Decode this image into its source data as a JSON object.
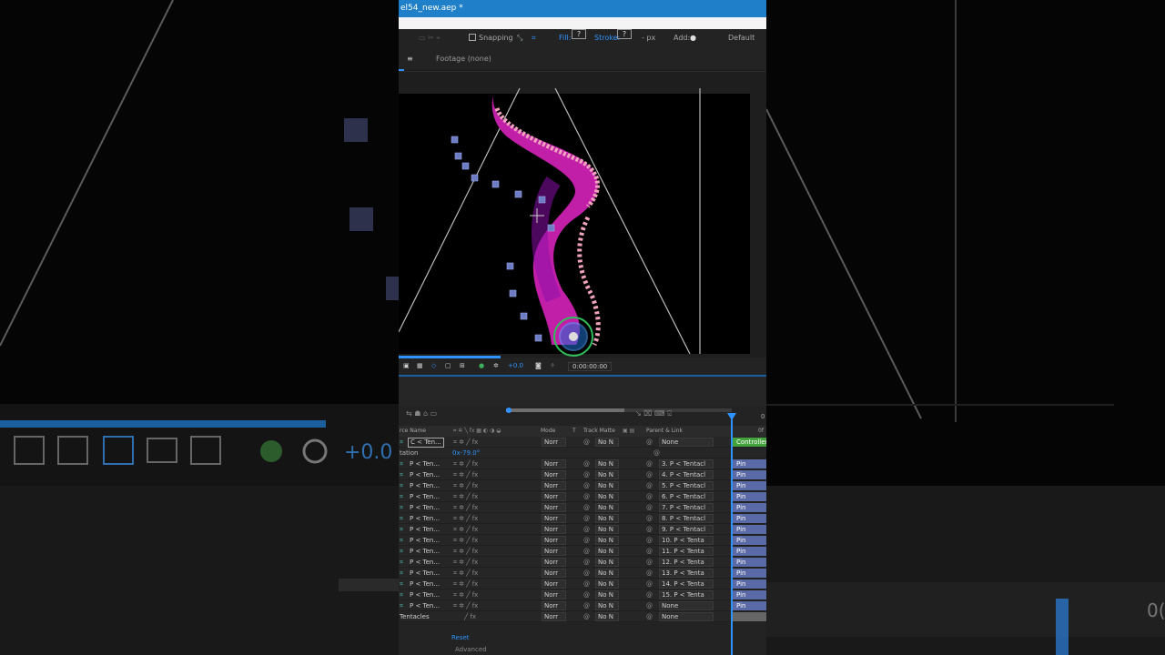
{
  "window": {
    "title": "el54_new.aep *"
  },
  "toolbar": {
    "snapping_label": "Snapping",
    "fill_label": "Fill:",
    "fill_value": "?",
    "stroke_label": "Stroke:",
    "stroke_value": "?",
    "stroke_unit": "- px",
    "add_label": "Add:",
    "workspace": "Default"
  },
  "panel": {
    "menu_icon": "≡",
    "footage_tab": "Footage (none)"
  },
  "viewer": {
    "exposure": "+0.0",
    "timecode": "0:00:00:00"
  },
  "timeline": {
    "headers": {
      "name": "rce Name",
      "mode": "Mode",
      "t": "T",
      "track_matte": "Track Matte",
      "parent": "Parent & Link",
      "ruler_end": "0f"
    },
    "controller": {
      "name": "C < Ten...",
      "mode": "Norr",
      "tm": "No N",
      "parent": "None",
      "bar": "Controller"
    },
    "rotation": {
      "label": "tation",
      "value": "0x-79.0°"
    },
    "rows": [
      {
        "name": "P < Ten...",
        "mode": "Norr",
        "tm": "No N",
        "parent": "3. P < Tentacl",
        "bar": "Pin"
      },
      {
        "name": "P < Ten...",
        "mode": "Norr",
        "tm": "No N",
        "parent": "4. P < Tentacl",
        "bar": "Pin"
      },
      {
        "name": "P < Ten...",
        "mode": "Norr",
        "tm": "No N",
        "parent": "5. P < Tentacl",
        "bar": "Pin"
      },
      {
        "name": "P < Ten...",
        "mode": "Norr",
        "tm": "No N",
        "parent": "6. P < Tentacl",
        "bar": "Pin"
      },
      {
        "name": "P < Ten...",
        "mode": "Norr",
        "tm": "No N",
        "parent": "7. P < Tentacl",
        "bar": "Pin"
      },
      {
        "name": "P < Ten...",
        "mode": "Norr",
        "tm": "No N",
        "parent": "8. P < Tentacl",
        "bar": "Pin"
      },
      {
        "name": "P < Ten...",
        "mode": "Norr",
        "tm": "No N",
        "parent": "9. P < Tentacl",
        "bar": "Pin"
      },
      {
        "name": "P < Ten...",
        "mode": "Norr",
        "tm": "No N",
        "parent": "10. P < Tenta",
        "bar": "Pin"
      },
      {
        "name": "P < Ten...",
        "mode": "Norr",
        "tm": "No N",
        "parent": "11. P < Tenta",
        "bar": "Pin"
      },
      {
        "name": "P < Ten...",
        "mode": "Norr",
        "tm": "No N",
        "parent": "12. P < Tenta",
        "bar": "Pin"
      },
      {
        "name": "P < Ten...",
        "mode": "Norr",
        "tm": "No N",
        "parent": "13. P < Tenta",
        "bar": "Pin"
      },
      {
        "name": "P < Ten...",
        "mode": "Norr",
        "tm": "No N",
        "parent": "14. P < Tenta",
        "bar": "Pin"
      },
      {
        "name": "P < Ten...",
        "mode": "Norr",
        "tm": "No N",
        "parent": "15. P < Tenta",
        "bar": "Pin"
      },
      {
        "name": "P < Ten...",
        "mode": "Norr",
        "tm": "No N",
        "parent": "None",
        "bar": "Pin"
      }
    ],
    "tentacles": {
      "name": "Tentacles",
      "mode": "Norr",
      "tm": "No N",
      "parent": "None"
    },
    "reset_label": "Reset",
    "advanced_label": "Advanced"
  },
  "colors": {
    "accent": "#1f7fc8",
    "pin_bar": "#5a6aa6",
    "controller_bar": "#43a23b",
    "tentacle": "#c21fa8"
  }
}
